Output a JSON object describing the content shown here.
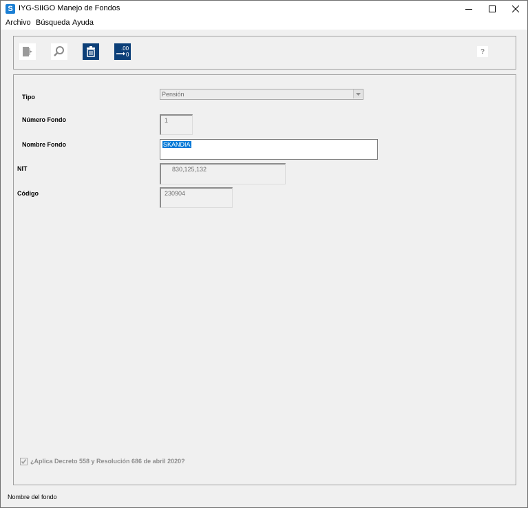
{
  "window": {
    "title": "IYG-SIIGO Manejo de Fondos",
    "app_icon_letter": "S",
    "controls": [
      "minimize-icon",
      "maximize-icon",
      "close-icon"
    ]
  },
  "menu": {
    "archivo": "Archivo",
    "busqueda": "Búsqueda",
    "ayuda": "Ayuda"
  },
  "toolbar": {
    "exit_icon": "exit-door-icon",
    "search_icon": "magnifier-icon",
    "delete_icon": "trash-icon",
    "decimal_icon": "decimal-format-icon",
    "decimal_text_top": ".00",
    "decimal_text_bottom": "0",
    "help_text": "?"
  },
  "form": {
    "tipo": {
      "label": "Tipo",
      "value": "Pensión"
    },
    "numero_fondo": {
      "label": "Número Fondo",
      "value": "1"
    },
    "nombre_fondo": {
      "label": "Nombre Fondo",
      "value": "SKANDIA"
    },
    "nit": {
      "label": "NIT",
      "value": "830,125,132"
    },
    "codigo": {
      "label": "Código",
      "value": "230904"
    },
    "aplica_decreto": {
      "label": "¿Aplica Decreto 558 y Resolución 686 de abril 2020?",
      "checked": true
    }
  },
  "status_bar": {
    "text": "Nombre del fondo"
  },
  "colors": {
    "accent": "#0c3f78",
    "selection": "#0078d7",
    "app_icon": "#1b7fd4"
  }
}
